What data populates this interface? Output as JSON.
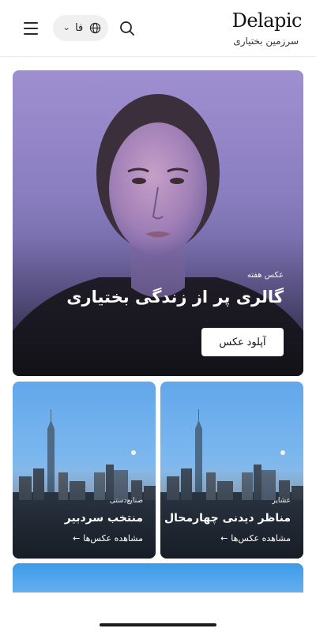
{
  "header": {
    "logo": "Delapic",
    "tagline": "سرزمین بختیاری",
    "language": {
      "label": "فا"
    },
    "icons": {
      "menu": "hamburger-menu-icon",
      "search": "search-icon",
      "globe": "globe-icon",
      "chevron": "chevron-down-icon"
    }
  },
  "hero": {
    "eyebrow": "عکس هفته",
    "title": "گالری پر از زندگی بختیاری",
    "button": "آپلود عکس"
  },
  "cards": [
    {
      "eyebrow": "عشایر",
      "title": "مناظر دیدنی چهارمحال",
      "link": "مشاهده عکس‌ها"
    },
    {
      "eyebrow": "صنایع‌دستی",
      "title": "منتخب سردبیر",
      "link": "مشاهده عکس‌ها"
    }
  ],
  "colors": {
    "accent": "#111111",
    "pill_bg": "#f0f0f0"
  }
}
